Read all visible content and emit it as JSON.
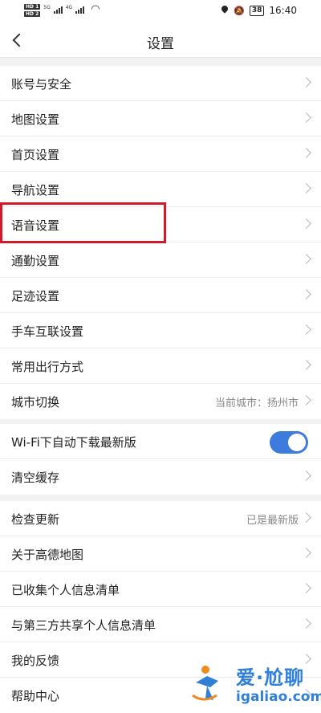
{
  "status_bar": {
    "hd1": "HD 1",
    "hd2": "HD 2",
    "net1": "5G",
    "net2": "4G",
    "battery": "38",
    "time": "16:40"
  },
  "header": {
    "title": "设置"
  },
  "group1": [
    {
      "label": "账号与安全",
      "value": ""
    },
    {
      "label": "地图设置",
      "value": ""
    },
    {
      "label": "首页设置",
      "value": ""
    },
    {
      "label": "导航设置",
      "value": ""
    },
    {
      "label": "语音设置",
      "value": ""
    },
    {
      "label": "通勤设置",
      "value": ""
    },
    {
      "label": "足迹设置",
      "value": ""
    },
    {
      "label": "手车互联设置",
      "value": ""
    },
    {
      "label": "常用出行方式",
      "value": ""
    },
    {
      "label": "城市切换",
      "value": "当前城市：扬州市"
    }
  ],
  "group2": {
    "wifi_download": {
      "label": "Wi-Fi下自动下载最新版",
      "enabled": true
    },
    "clear_cache": {
      "label": "清空缓存"
    }
  },
  "group3": [
    {
      "label": "检查更新",
      "value": "已是最新版"
    },
    {
      "label": "关于高德地图",
      "value": ""
    },
    {
      "label": "已收集个人信息清单",
      "value": ""
    },
    {
      "label": "与第三方共享个人信息清单",
      "value": ""
    },
    {
      "label": "我的反馈",
      "value": ""
    },
    {
      "label": "帮助中心",
      "value": ""
    }
  ],
  "watermark": {
    "title": "爱·尬聊",
    "url": "igaliao.com"
  },
  "colors": {
    "accent": "#3d7bdc",
    "highlight": "#d11a2a",
    "watermark": "#2f80d6"
  }
}
